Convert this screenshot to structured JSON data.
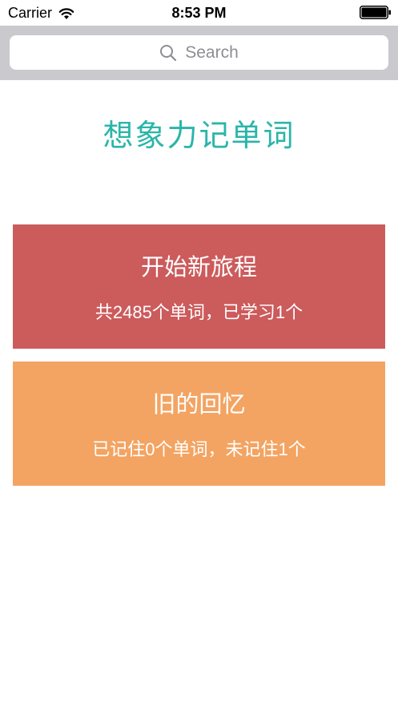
{
  "status_bar": {
    "carrier": "Carrier",
    "time": "8:53 PM"
  },
  "search": {
    "placeholder": "Search"
  },
  "app_title": "想象力记单词",
  "cards": [
    {
      "title": "开始新旅程",
      "subtitle": "共2485个单词，已学习1个",
      "color": "#cc5b5c"
    },
    {
      "title": "旧的回忆",
      "subtitle": "已记住0个单词，未记住1个",
      "color": "#f3a462"
    }
  ],
  "colors": {
    "accent": "#2bb5a9",
    "search_bar_bg": "#c9c9ce"
  },
  "icons": {
    "wifi": "wifi-icon",
    "battery": "battery-icon",
    "search": "search-icon"
  }
}
